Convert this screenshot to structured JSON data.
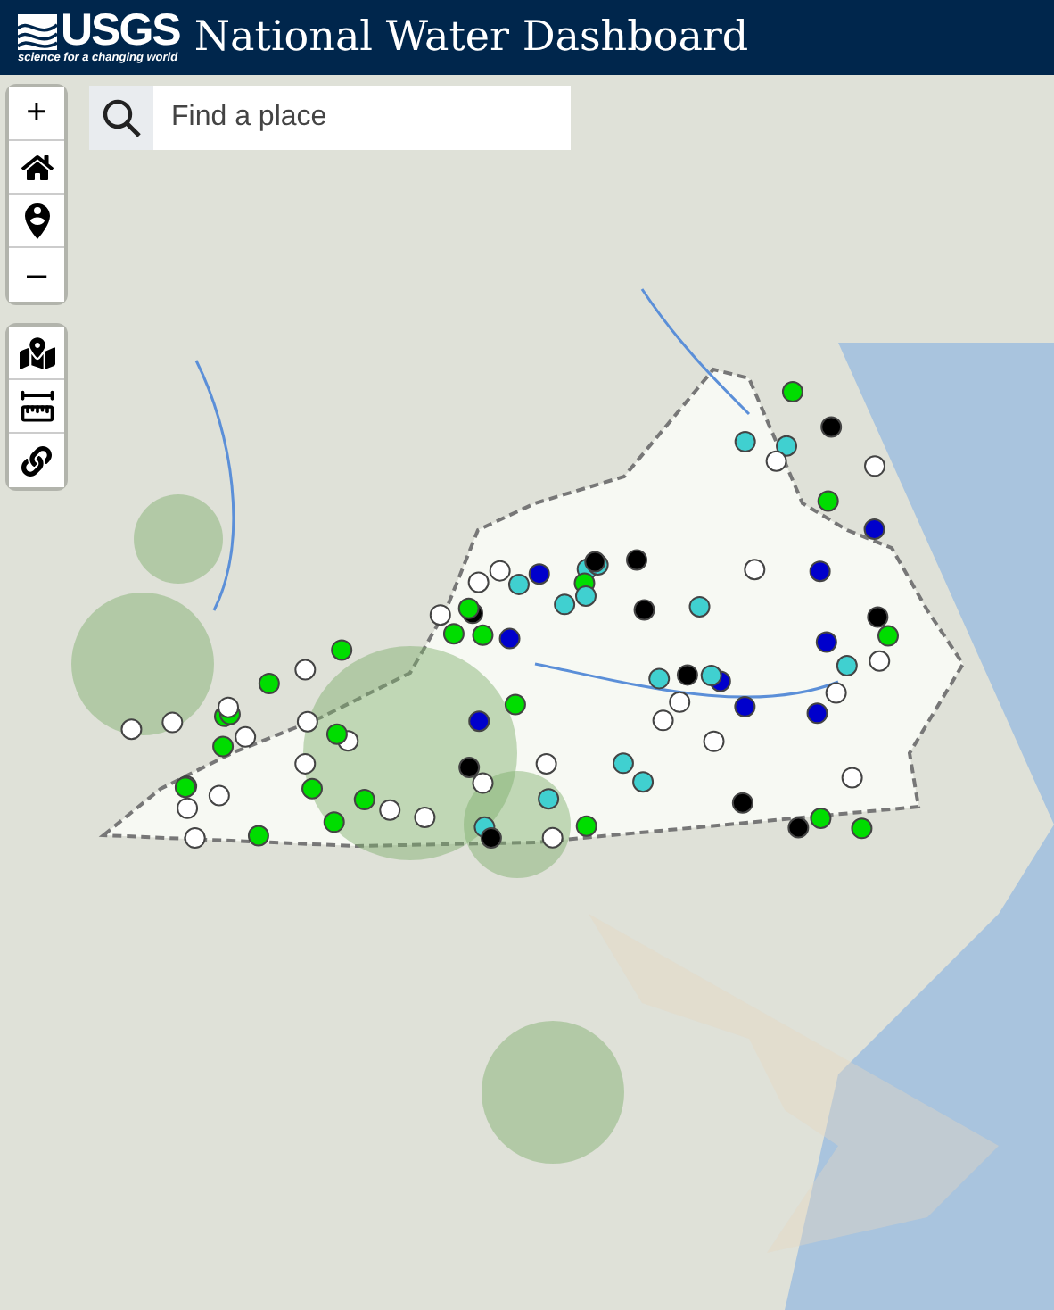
{
  "header": {
    "logo_text": "USGS",
    "tagline": "science for a changing world",
    "title": "National Water Dashboard"
  },
  "map_controls": [
    {
      "kind": "text",
      "label": "+"
    },
    {
      "kind": "home"
    },
    {
      "kind": "locate"
    },
    {
      "kind": "text",
      "label": "–"
    }
  ],
  "tool_controls": [
    {
      "kind": "layers"
    },
    {
      "kind": "measure"
    },
    {
      "kind": "link"
    }
  ],
  "search": {
    "placeholder": "Find a place"
  }
}
